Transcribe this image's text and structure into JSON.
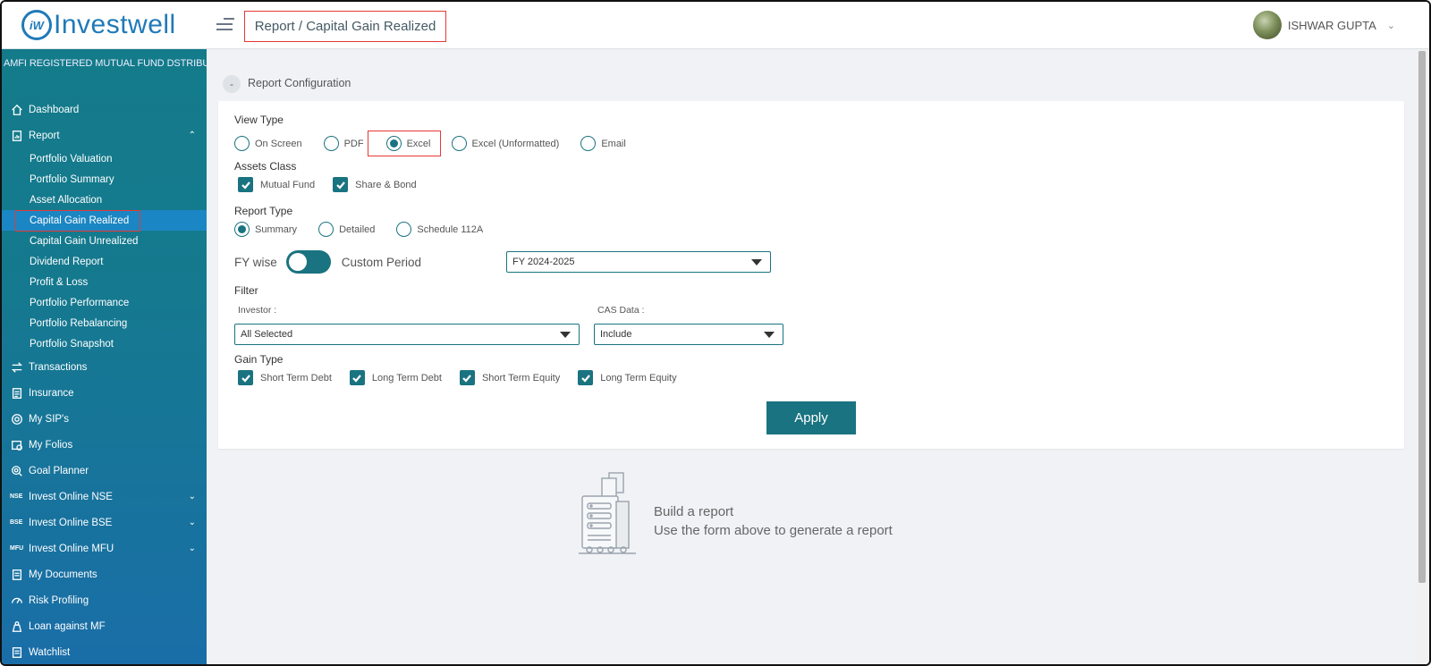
{
  "header": {
    "logo_mark": "iW",
    "logo_text": "Investwell",
    "breadcrumb": "Report / Capital Gain Realized",
    "user_name": "ISHWAR GUPTA"
  },
  "sidebar": {
    "tagline": "AMFI REGISTERED MUTUAL FUND DSTRIBUTOR",
    "items": [
      {
        "label": "Dashboard",
        "icon": "home-icon"
      },
      {
        "label": "Report",
        "icon": "report-icon",
        "expanded": true
      },
      {
        "label": "Transactions",
        "icon": "transfer-icon"
      },
      {
        "label": "Insurance",
        "icon": "document-icon"
      },
      {
        "label": "My SIP's",
        "icon": "sip-icon"
      },
      {
        "label": "My Folios",
        "icon": "folio-icon"
      },
      {
        "label": "Goal Planner",
        "icon": "target-icon"
      },
      {
        "label": "Invest Online NSE",
        "tag": "NSE"
      },
      {
        "label": "Invest Online BSE",
        "tag": "BSE"
      },
      {
        "label": "Invest Online MFU",
        "tag": "MFU"
      },
      {
        "label": "My Documents",
        "icon": "document-icon"
      },
      {
        "label": "Risk Profiling",
        "icon": "gauge-icon"
      },
      {
        "label": "Loan against MF",
        "icon": "loan-icon"
      },
      {
        "label": "Watchlist",
        "icon": "document-icon"
      }
    ],
    "report_sub": [
      "Portfolio Valuation",
      "Portfolio Summary",
      "Asset Allocation",
      "Capital Gain Realized",
      "Capital Gain Unrealized",
      "Dividend Report",
      "Profit & Loss",
      "Portfolio Performance",
      "Portfolio Rebalancing",
      "Portfolio Snapshot"
    ],
    "active_sub": "Capital Gain Realized"
  },
  "main": {
    "config_toggle": "-",
    "config_label": "Report Configuration",
    "view_type": {
      "title": "View Type",
      "options": [
        "On Screen",
        "PDF",
        "Excel",
        "Excel (Unformatted)",
        "Email"
      ],
      "selected": "Excel"
    },
    "assets_class": {
      "title": "Assets Class",
      "options": [
        "Mutual Fund",
        "Share & Bond"
      ],
      "checked": [
        "Mutual Fund",
        "Share & Bond"
      ]
    },
    "report_type": {
      "title": "Report Type",
      "options": [
        "Summary",
        "Detailed",
        "Schedule 112A"
      ],
      "selected": "Summary"
    },
    "period": {
      "left_label": "FY wise",
      "right_label": "Custom Period",
      "fy_value": "FY 2024-2025"
    },
    "filter": {
      "title": "Filter",
      "investor_label": "Investor :",
      "investor_value": "All Selected",
      "cas_label": "CAS Data :",
      "cas_value": "Include"
    },
    "gain_type": {
      "title": "Gain Type",
      "options": [
        "Short Term Debt",
        "Long Term Debt",
        "Short Term Equity",
        "Long Term Equity"
      ],
      "checked": [
        "Short Term Debt",
        "Long Term Debt",
        "Short Term Equity",
        "Long Term Equity"
      ]
    },
    "apply_label": "Apply",
    "empty_state": {
      "title": "Build a report",
      "subtitle": "Use the form above to generate a report"
    }
  },
  "colors": {
    "accent": "#1a7380",
    "brand": "#1f7ab8",
    "highlight_border": "#e53935"
  }
}
